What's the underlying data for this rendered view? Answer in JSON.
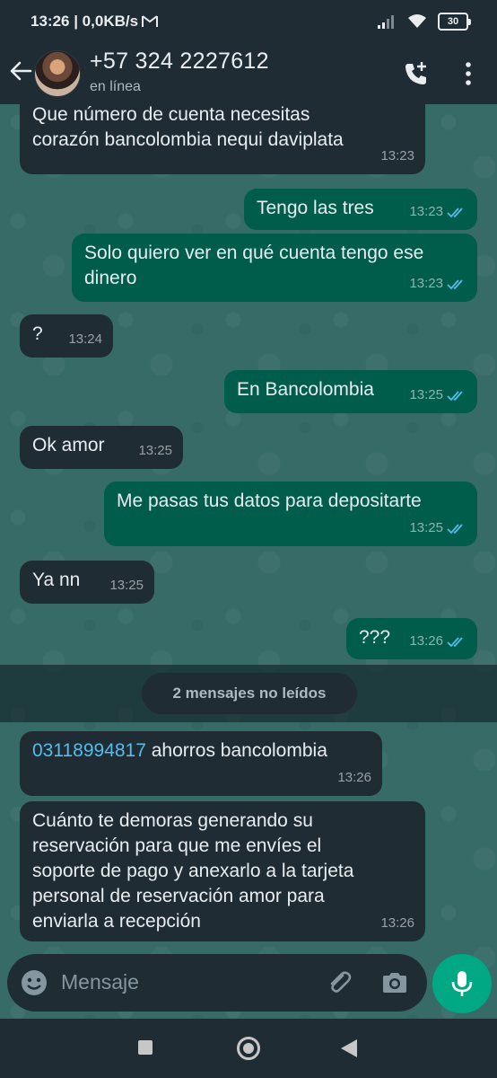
{
  "status_bar": {
    "time_network": "13:26 | 0,0KB/s",
    "battery": "30"
  },
  "header": {
    "contact_name": "+57 324 2227612",
    "contact_status": "en línea"
  },
  "messages": [
    {
      "dir": "in",
      "text_lines": [
        "Que número de cuenta necesitas",
        "corazón bancolombia nequi daviplata"
      ],
      "time": "13:23"
    },
    {
      "dir": "out",
      "text": "Tengo las tres",
      "time": "13:23",
      "read": true
    },
    {
      "dir": "out",
      "text_lines": [
        "Solo quiero ver en qué cuenta tengo ese",
        "dinero"
      ],
      "time": "13:23",
      "read": true
    },
    {
      "dir": "in",
      "text": "?",
      "time": "13:24"
    },
    {
      "dir": "out",
      "text": "En Bancolombia",
      "time": "13:25",
      "read": true
    },
    {
      "dir": "in",
      "text": "Ok amor",
      "time": "13:25"
    },
    {
      "dir": "out",
      "text": "Me pasas tus datos para depositarte",
      "time": "13:25",
      "read": true
    },
    {
      "dir": "in",
      "text": "Ya nn",
      "time": "13:25"
    },
    {
      "dir": "out",
      "text": "???",
      "time": "13:26",
      "read": true
    },
    {
      "dir": "in",
      "account_number": "03118994817",
      "text": " ahorros bancolombia",
      "time": "13:26"
    },
    {
      "dir": "in",
      "text_lines": [
        "Cuánto te demoras generando su",
        "reservación para que me envíes el",
        "soporte de pago y anexarlo a la tarjeta",
        "personal de reservación amor para",
        "enviarla a recepción"
      ],
      "time": "13:26"
    }
  ],
  "unread_divider": "2 mensajes no leídos",
  "composer": {
    "placeholder": "Mensaje"
  },
  "colors": {
    "incoming_bubble": "#202c33",
    "outgoing_bubble": "#005c4b",
    "accent": "#00a884",
    "read_ticks": "#53bdeb"
  }
}
